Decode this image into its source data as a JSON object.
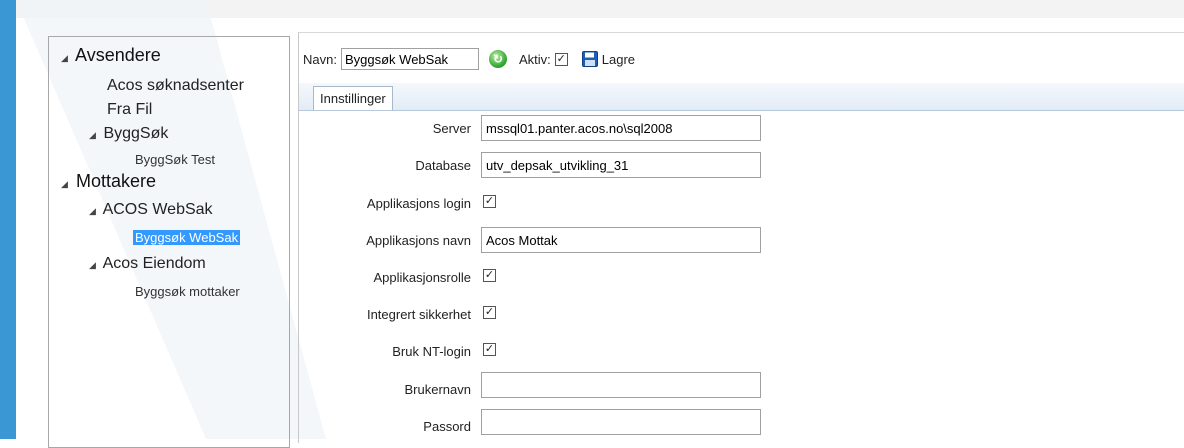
{
  "tree": {
    "groups": [
      {
        "label": "Avsendere",
        "children": [
          {
            "label": "Acos søknadsenter"
          },
          {
            "label": "Fra Fil"
          },
          {
            "label": "ByggSøk",
            "children": [
              {
                "label": "ByggSøk Test"
              }
            ]
          }
        ]
      },
      {
        "label": "Mottakere",
        "children": [
          {
            "label": "ACOS WebSak",
            "children": [
              {
                "label": "Byggsøk WebSak",
                "selected": true
              }
            ]
          },
          {
            "label": "Acos Eiendom",
            "children": [
              {
                "label": "Byggsøk mottaker"
              }
            ]
          }
        ]
      }
    ]
  },
  "toolbar": {
    "name_label": "Navn:",
    "name_value": "Byggsøk WebSak",
    "active_label": "Aktiv:",
    "active_checked": true,
    "save_label": "Lagre"
  },
  "tabs": [
    {
      "label": "Innstillinger"
    }
  ],
  "form": {
    "server_label": "Server",
    "server_value": "mssql01.panter.acos.no\\sql2008",
    "database_label": "Database",
    "database_value": "utv_depsak_utvikling_31",
    "app_login_label": "Applikasjons login",
    "app_name_label": "Applikasjons navn",
    "app_name_value": "Acos Mottak",
    "app_role_label": "Applikasjonsrolle",
    "integrated_security_label": "Integrert sikkerhet",
    "nt_login_label": "Bruk NT-login",
    "username_label": "Brukernavn",
    "username_value": "",
    "password_label": "Passord",
    "password_value": "",
    "check_mark": "✓"
  },
  "colors": {
    "accent": "#3a97d4",
    "selection": "#3399ff"
  }
}
